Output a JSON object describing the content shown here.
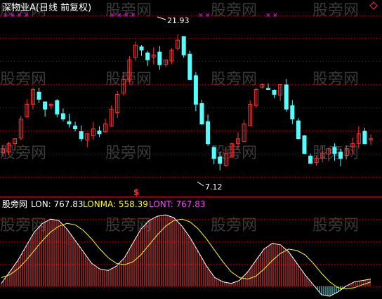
{
  "chart_data": [
    {
      "type": "candlestick",
      "title": "深物业A(日线 前复权)",
      "price_annotations": [
        {
          "label": "21.93",
          "value": 21.93
        },
        {
          "label": "7.12",
          "value": 7.12
        }
      ],
      "signal_marker": "$",
      "ylim": [
        5.5,
        23.5
      ],
      "colors": {
        "up": "#ff3232",
        "down": "#54ffff",
        "grid": "#a00000",
        "text": "#ffffff",
        "marker": "#ff00ff"
      },
      "approx_close": [
        10,
        10.5,
        11,
        13,
        14.5,
        16,
        15,
        14,
        14.5,
        13.5,
        13,
        12.5,
        12,
        11,
        11.5,
        12,
        11.5,
        12.5,
        14,
        15.5,
        17,
        19,
        20.5,
        20,
        19,
        19.5,
        18.5,
        19,
        20,
        21,
        19.5,
        17,
        14.5,
        12.5,
        10.5,
        9,
        8.5,
        9.5,
        10.5,
        11,
        12.5,
        14.5,
        16,
        16.5,
        16,
        15.5,
        16.5,
        14,
        13,
        11,
        9.5,
        8.5,
        9,
        9.5,
        10,
        9.5,
        9,
        10,
        10.5,
        11.5,
        10.5,
        11
      ]
    },
    {
      "type": "bar+line",
      "legend": [
        {
          "name": "LON",
          "label": "LON: 767.83",
          "color": "#ffffff"
        },
        {
          "name": "LONMA",
          "label": "LONMA: 558.39",
          "color": "#ffff00"
        },
        {
          "name": "LONT",
          "label": "LONT: 767.83",
          "color": "#ff40ff"
        }
      ],
      "ylim": [
        -400,
        2600
      ],
      "lon": [
        100,
        500,
        900,
        1400,
        1900,
        2200,
        2350,
        2300,
        2000,
        1600,
        1200,
        800,
        600,
        550,
        700,
        1000,
        1500,
        2000,
        2300,
        2450,
        2500,
        2400,
        2100,
        1700,
        1200,
        700,
        300,
        150,
        100,
        200,
        500,
        900,
        1300,
        1500,
        1450,
        1200,
        800,
        400,
        50,
        -300,
        -350,
        -200,
        0,
        150,
        200,
        250
      ],
      "lonma": [
        300,
        400,
        600,
        900,
        1250,
        1600,
        1900,
        2100,
        2200,
        2150,
        1950,
        1650,
        1300,
        1000,
        800,
        750,
        850,
        1100,
        1450,
        1800,
        2100,
        2300,
        2350,
        2250,
        2000,
        1650,
        1250,
        850,
        500,
        300,
        250,
        350,
        600,
        900,
        1150,
        1300,
        1250,
        1100,
        800,
        450,
        150,
        -50,
        -100,
        -50,
        50,
        150
      ],
      "colors": {
        "hist_pos": "#ff4040",
        "hist_neg": "#54ffff",
        "grid": "#a00000"
      }
    }
  ],
  "watermark": "股旁网"
}
